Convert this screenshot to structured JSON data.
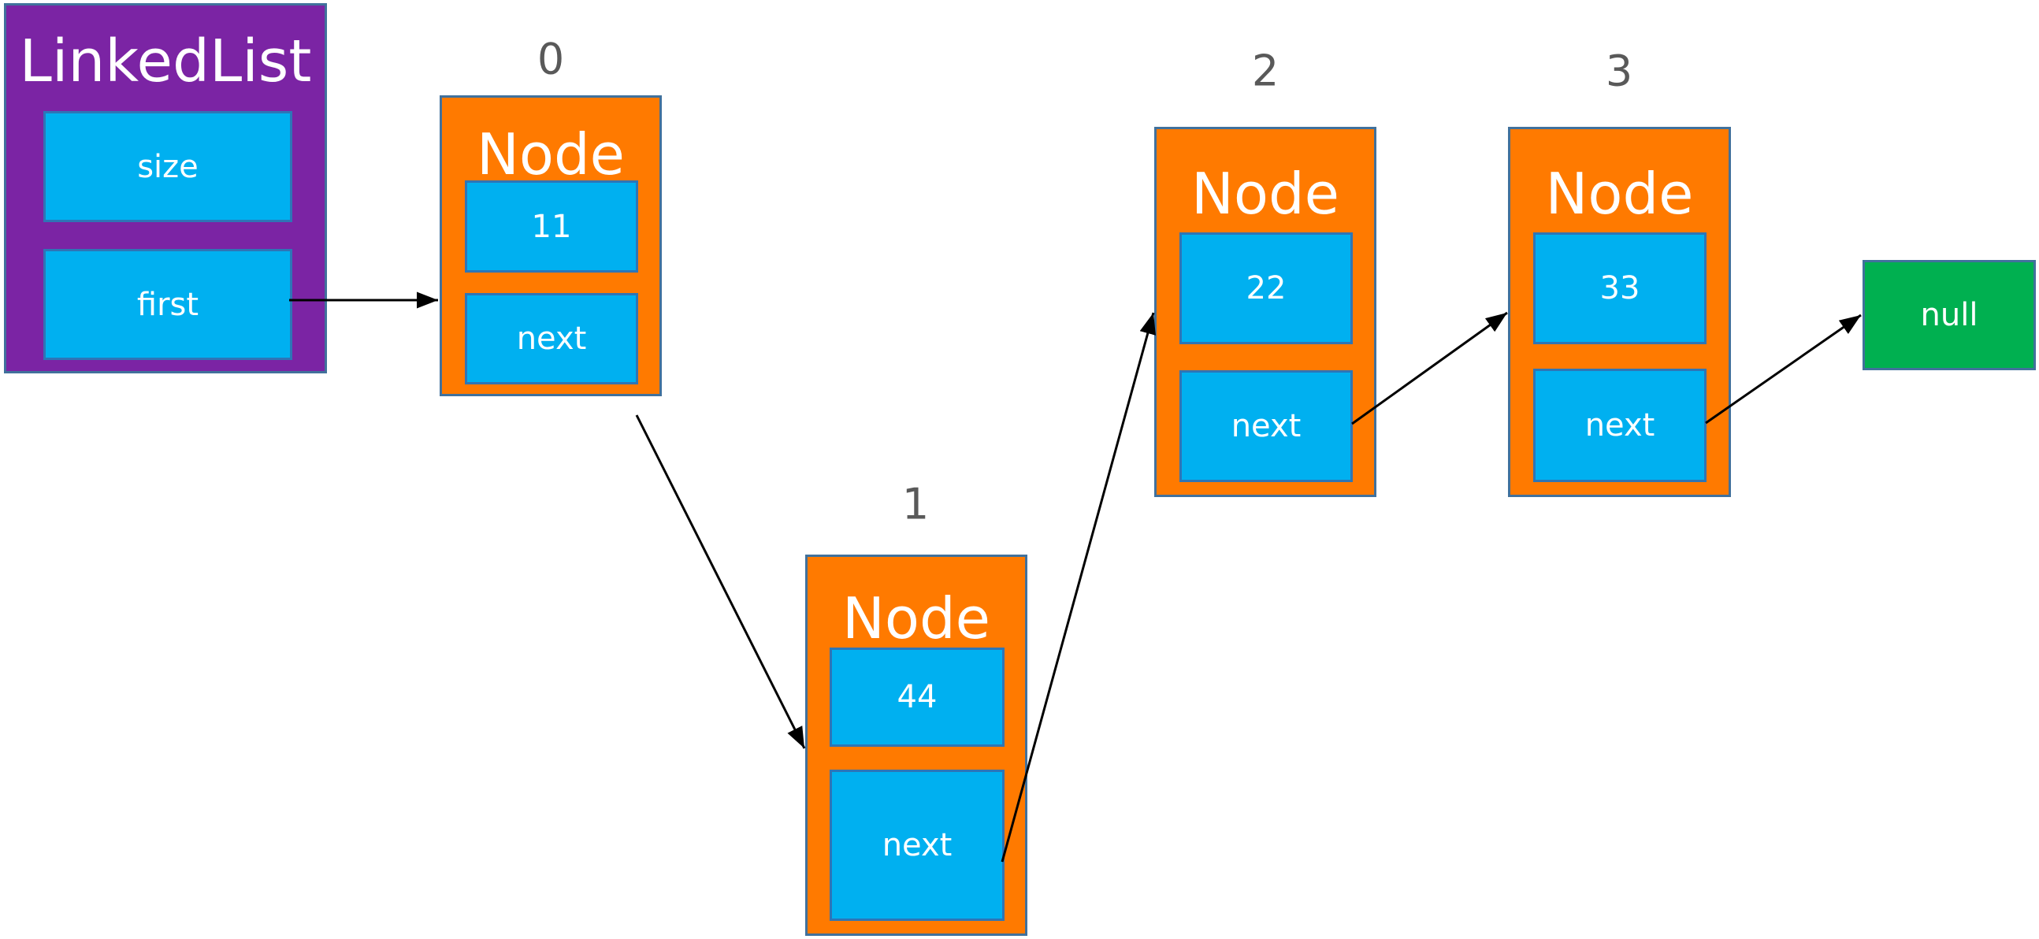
{
  "linked_list": {
    "title": "LinkedList",
    "fields": [
      "size",
      "first"
    ]
  },
  "nodes": [
    {
      "index": "0",
      "title": "Node",
      "value": "11",
      "next_label": "next"
    },
    {
      "index": "1",
      "title": "Node",
      "value": "44",
      "next_label": "next"
    },
    {
      "index": "2",
      "title": "Node",
      "value": "22",
      "next_label": "next"
    },
    {
      "index": "3",
      "title": "Node",
      "value": "33",
      "next_label": "next"
    }
  ],
  "terminal": {
    "label": "null"
  },
  "edges": [
    {
      "from": "first",
      "to": "node-0"
    },
    {
      "from": "node-0.next",
      "to": "node-1"
    },
    {
      "from": "node-1.next",
      "to": "node-2"
    },
    {
      "from": "node-2.next",
      "to": "node-3"
    },
    {
      "from": "node-3.next",
      "to": "null"
    }
  ],
  "colors": {
    "linked_list": "#7B24A4",
    "node": "#FF7A00",
    "field": "#00B0F0",
    "null": "#00B050",
    "index_label": "#595959"
  }
}
